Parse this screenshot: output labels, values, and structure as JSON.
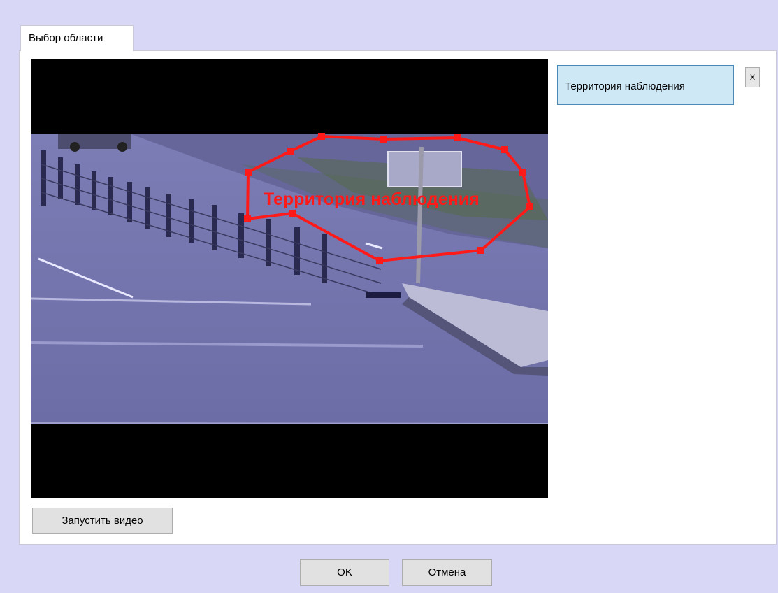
{
  "tabs": [
    {
      "label": "Выбор области",
      "active": true
    }
  ],
  "zones": [
    {
      "label": "Территория наблюдения",
      "color": "#ff1a1a"
    }
  ],
  "zone_list": {
    "close_label": "x"
  },
  "video": {
    "start_label": "Запустить видео"
  },
  "dialog": {
    "ok_label": "OK",
    "cancel_label": "Отмена"
  },
  "colors": {
    "background": "#d8d8f6",
    "panel": "#ffffff",
    "selected_zone": "#cfe8f6",
    "zone_outline": "#ff1a1a"
  }
}
